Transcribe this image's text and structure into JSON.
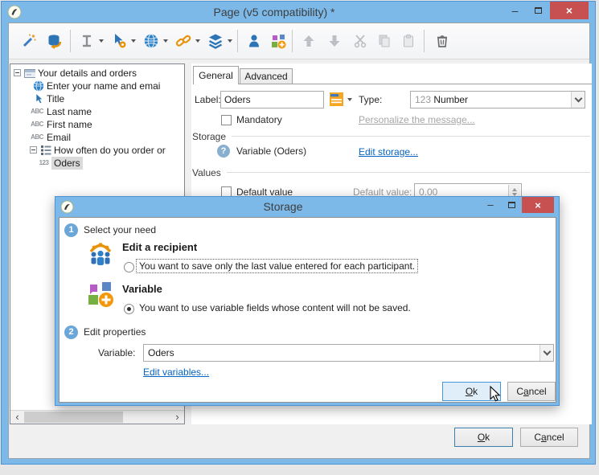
{
  "colors": {
    "frame_blue": "#7db9e8",
    "close_red": "#c75050",
    "link_blue": "#0563c1",
    "disabled_link_gray": "#a6a6a6",
    "tree_selection_gray": "#dadada"
  },
  "main_window": {
    "title": "Page (v5 compatibility) *",
    "window_buttons": {
      "minimize": "–",
      "maximize": "",
      "close": "×"
    },
    "toolbar": {
      "buttons": [
        {
          "icon": "magic-wand-icon",
          "enabled": true,
          "dropdown": false
        },
        {
          "icon": "data-mapping-icon",
          "enabled": true,
          "dropdown": false
        },
        {
          "icon": "field-height-icon",
          "enabled": true,
          "dropdown": true
        },
        {
          "icon": "field-properties-icon",
          "enabled": true,
          "dropdown": true
        },
        {
          "icon": "web-icon",
          "enabled": true,
          "dropdown": true
        },
        {
          "icon": "link-icon",
          "enabled": true,
          "dropdown": true
        },
        {
          "icon": "layers-icon",
          "enabled": true,
          "dropdown": true
        },
        {
          "icon": "recipient-icon",
          "enabled": true,
          "dropdown": false
        },
        {
          "icon": "variable-icon",
          "enabled": true,
          "dropdown": false
        },
        {
          "icon": "move-up-icon",
          "enabled": false,
          "dropdown": false
        },
        {
          "icon": "move-down-icon",
          "enabled": false,
          "dropdown": false
        },
        {
          "icon": "cut-icon",
          "enabled": false,
          "dropdown": false
        },
        {
          "icon": "copy-icon",
          "enabled": false,
          "dropdown": false
        },
        {
          "icon": "paste-icon",
          "enabled": false,
          "dropdown": false
        },
        {
          "icon": "delete-icon",
          "enabled": true,
          "dropdown": false
        }
      ]
    },
    "tree": {
      "items": [
        {
          "label": "Your details and orders",
          "icon": "form-icon",
          "level": 0,
          "expanded": true
        },
        {
          "label": "Enter your name and emai",
          "icon": "web-page-icon",
          "level": 1
        },
        {
          "label": "Title",
          "icon": "cursor-field-icon",
          "level": 1
        },
        {
          "label": "Last name",
          "icon": "abc-text-icon",
          "level": 1
        },
        {
          "label": "First name",
          "icon": "abc-text-icon",
          "level": 1
        },
        {
          "label": "Email",
          "icon": "abc-text-icon",
          "level": 1
        },
        {
          "label": "How often do you order or",
          "icon": "choice-list-icon",
          "level": 1,
          "expanded": true
        },
        {
          "label": "Oders",
          "icon": "number-123-icon",
          "level": 2,
          "selected": true
        }
      ]
    },
    "tabs": {
      "general": "General",
      "advanced": "Advanced"
    },
    "general_tab": {
      "label_caption": "Label:",
      "label_value": "Oders",
      "type_caption": "Type:",
      "type_icon": "123",
      "type_value": "Number",
      "mandatory_label": "Mandatory",
      "mandatory_checked": false,
      "personalize_link": "Personalize the message...",
      "storage_group_title": "Storage",
      "storage_value": "Variable (Oders)",
      "edit_storage_link": "Edit storage...",
      "values_group_title": "Values",
      "default_checkbox_label": "Default value",
      "default_checked": false,
      "default_value_caption": "Default value:",
      "default_value": "0.00"
    },
    "ok_button": {
      "text": "Ok",
      "underline": 0
    },
    "cancel_button": {
      "text": "Cancel",
      "underline": 1
    }
  },
  "storage_dialog": {
    "title": "Storage",
    "window_buttons": {
      "minimize": "–",
      "maximize": "",
      "close": "×"
    },
    "step1_number": "1",
    "step1_title": "Select your need",
    "recipient_heading": "Edit a recipient",
    "recipient_radio_label": "You want to save only the last value entered for each participant.",
    "recipient_radio_checked": false,
    "variable_heading": "Variable",
    "variable_radio_label": "You want to use variable fields whose content will not be saved.",
    "variable_radio_checked": true,
    "step2_number": "2",
    "step2_title": "Edit properties",
    "variable_caption": "Variable:",
    "variable_value": "Oders",
    "edit_variables_link": "Edit variables...",
    "ok_button": {
      "text": "Ok",
      "underline": 0
    },
    "cancel_button": {
      "text": "Cancel",
      "underline": 1
    }
  }
}
